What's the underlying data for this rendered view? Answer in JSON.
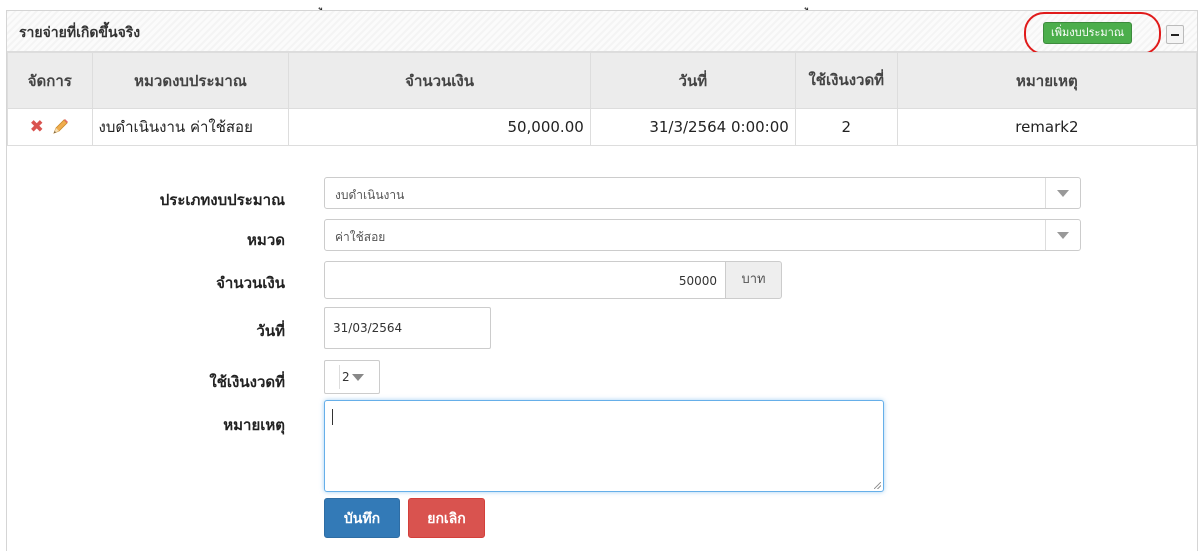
{
  "top_fragment": {
    "a": "ู",
    "b": "ู"
  },
  "panel": {
    "title": "รายจ่ายที่เกิดขึ้นจริง",
    "add_button": "เพิ่มงบประมาณ"
  },
  "table": {
    "headers": {
      "actions": "จัดการ",
      "category": "หมวดงบประมาณ",
      "amount": "จำนวนเงิน",
      "date": "วันที่",
      "installment": "ใช้เงินงวดที่",
      "remark": "หมายเหตุ"
    },
    "rows": [
      {
        "category": "งบดำเนินงาน ค่าใช้สอย",
        "amount": "50,000.00",
        "date": "31/3/2564 0:00:00",
        "installment": "2",
        "remark": "remark2"
      }
    ]
  },
  "form": {
    "budget_type": {
      "label": "ประเภทงบประมาณ",
      "value": "งบดำเนินงาน"
    },
    "category": {
      "label": "หมวด",
      "value": "ค่าใช้สอย"
    },
    "amount": {
      "label": "จำนวนเงิน",
      "value": "50000",
      "unit": "บาท"
    },
    "date": {
      "label": "วันที่",
      "value": "31/03/2564"
    },
    "installment": {
      "label": "ใช้เงินงวดที่",
      "value": "2"
    },
    "remark": {
      "label": "หมายเหตุ",
      "value": ""
    },
    "save_label": "บันทึก",
    "cancel_label": "ยกเลิก"
  },
  "colors": {
    "accent_green": "#4cae4c",
    "primary_blue": "#337ab7",
    "danger_red": "#d9534f",
    "highlight": "#e01b1b"
  }
}
